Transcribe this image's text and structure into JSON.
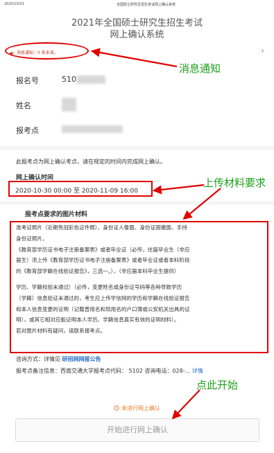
{
  "print_header": {
    "date": "2020/10/31",
    "title": "全国硕士研究生招生考试网上确认系统"
  },
  "page": {
    "title_line1": "2021年全国硕士研究生招生考试",
    "title_line2": "网上确认系统"
  },
  "notice": {
    "text": "消息通知：0 条未读。"
  },
  "fields": [
    {
      "label": "报名号",
      "value": "510"
    },
    {
      "label": "姓名",
      "value": ""
    },
    {
      "label": "报考点",
      "value": ""
    }
  ],
  "intro": "此报考点为网上确认考点，请在规定的时间内完成网上确认。",
  "confirm_time": {
    "heading": "网上确认时间",
    "range": "2020-10-30 00:00 至 2020-11-09 16:00"
  },
  "materials": {
    "heading": "报考点要求的图片材料",
    "lines": [
      "准考证照片（近期免冠彩色证件照）、身份证人像面、身份证国徽面、手持",
      "身份证照片。",
      "《教育部学历证书电子注册备案表》或者毕业证（必传，往届毕业生（非应",
      "届生）须上传《教育部学历证书电子注册备案表》或者毕业证或者本科阶段",
      "的《教育部学籍在线验证报告》，三选一。），（非应届本科毕业生提供）",
      "",
      "学历、学籍校验未通过）（必传，变更姓名或身份证号码等各种导致学历",
      "（学籍）信息验证未通过的，考生应上传学信网的学历和学籍在线验证报告",
      "和本人信息变更的证明（记载曾用名和现用名的户口簿或公安机关出具的证",
      "明），或其它相对应能证明本人学历、学籍信息真实有效的证明材料）。",
      "若对图片材料有疑问，请联系报考点。"
    ]
  },
  "contact": {
    "prefix": "咨询方式：详情见 ",
    "link": "研招网网报公告"
  },
  "remark": {
    "text": "报考点备注信息：西南交通大学报考点代码： 5102 咨询电话：028-... ",
    "link": "详情"
  },
  "status": {
    "icon": "clock-icon",
    "text": "未进行网上确认"
  },
  "button": {
    "label": "开始进行网上确认"
  },
  "annotations": {
    "notice": "消息通知",
    "materials": "上传材料要求",
    "start": "点此开始"
  },
  "colors": {
    "annotation_red": "#e00000",
    "annotation_green": "#1ca01c",
    "link_blue": "#2a6fc9",
    "status_orange": "#e77c2a"
  }
}
